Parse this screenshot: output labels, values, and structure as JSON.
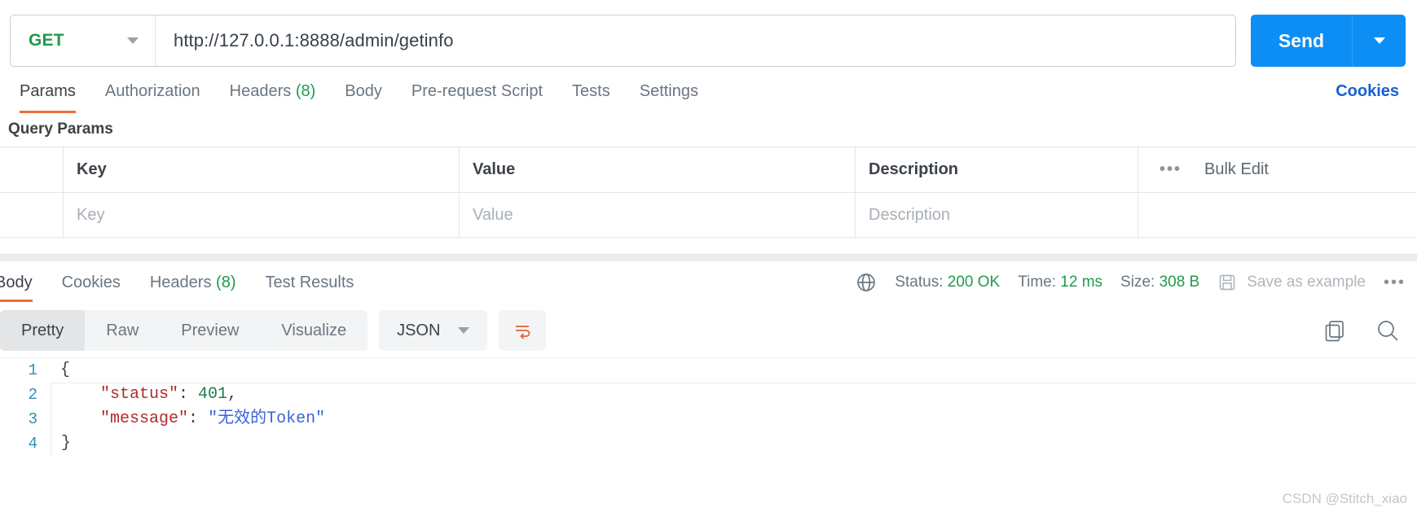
{
  "request": {
    "method": "GET",
    "url": "http://127.0.0.1:8888/admin/getinfo",
    "send_label": "Send",
    "tabs": [
      {
        "label": "Params",
        "count": "",
        "active": true
      },
      {
        "label": "Authorization",
        "count": "",
        "active": false
      },
      {
        "label": "Headers",
        "count": "(8)",
        "active": false
      },
      {
        "label": "Body",
        "count": "",
        "active": false
      },
      {
        "label": "Pre-request Script",
        "count": "",
        "active": false
      },
      {
        "label": "Tests",
        "count": "",
        "active": false
      },
      {
        "label": "Settings",
        "count": "",
        "active": false
      }
    ],
    "cookies_link": "Cookies"
  },
  "query_params": {
    "title": "Query Params",
    "columns": [
      "Key",
      "Value",
      "Description"
    ],
    "bulk_edit_label": "Bulk Edit",
    "rows": [
      {
        "key": "Key",
        "value": "Value",
        "description": "Description"
      }
    ]
  },
  "response": {
    "tabs": [
      {
        "label": "Body",
        "count": "",
        "active": true
      },
      {
        "label": "Cookies",
        "count": "",
        "active": false
      },
      {
        "label": "Headers",
        "count": "(8)",
        "active": false
      },
      {
        "label": "Test Results",
        "count": "",
        "active": false
      }
    ],
    "status_label": "Status:",
    "status_value": "200 OK",
    "time_label": "Time:",
    "time_value": "12 ms",
    "size_label": "Size:",
    "size_value": "308 B",
    "save_example_label": "Save as example",
    "format_tabs": [
      {
        "label": "Pretty",
        "active": true
      },
      {
        "label": "Raw",
        "active": false
      },
      {
        "label": "Preview",
        "active": false
      },
      {
        "label": "Visualize",
        "active": false
      }
    ],
    "language": "JSON",
    "body_lines": [
      {
        "num": "1",
        "indent": "",
        "segments": [
          {
            "text": "{",
            "type": "punc"
          }
        ]
      },
      {
        "num": "2",
        "indent": "    ",
        "segments": [
          {
            "text": "\"status\"",
            "type": "key"
          },
          {
            "text": ": ",
            "type": "punc"
          },
          {
            "text": "401",
            "type": "num"
          },
          {
            "text": ",",
            "type": "punc"
          }
        ]
      },
      {
        "num": "3",
        "indent": "    ",
        "segments": [
          {
            "text": "\"message\"",
            "type": "key"
          },
          {
            "text": ": ",
            "type": "punc"
          },
          {
            "text": "\"无效的Token\"",
            "type": "str"
          }
        ]
      },
      {
        "num": "4",
        "indent": "",
        "segments": [
          {
            "text": "}",
            "type": "punc"
          }
        ]
      }
    ]
  },
  "watermark": "CSDN @Stitch_xiao",
  "colors": {
    "accent_orange": "#ef6c34",
    "send_blue": "#0d8ef5",
    "link_blue": "#1560d4",
    "method_green": "#1f9a4c",
    "status_green": "#1f9a4c"
  }
}
